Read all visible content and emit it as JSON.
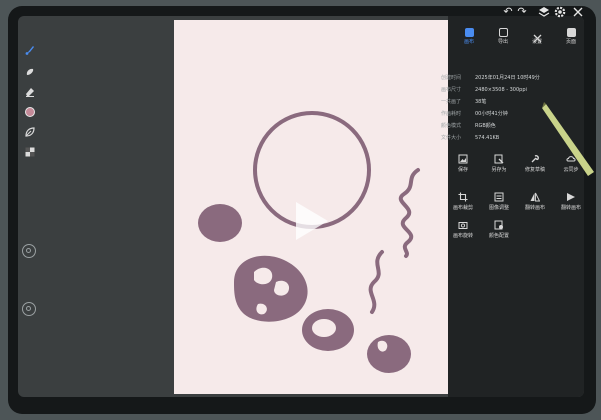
{
  "colors": {
    "canvas": "#f6eaea",
    "ink": "#8a6a7e",
    "panel": "#202324",
    "accent": "#4a8cf0"
  },
  "topbar": {
    "icons": [
      "undo-icon",
      "redo-icon",
      "layers-icon",
      "gear-icon",
      "close-icon"
    ]
  },
  "tabs": [
    {
      "label": "画布",
      "icon": "canvas-icon"
    },
    {
      "label": "导出",
      "icon": "export-icon"
    },
    {
      "label": "设置",
      "icon": "settings-icon"
    },
    {
      "label": "页面",
      "icon": "page-icon"
    }
  ],
  "info": [
    {
      "key": "创建时间",
      "value": "2025年01月24日 10时49分"
    },
    {
      "key": "画布尺寸",
      "value": "2480×3508 - 300ppi"
    },
    {
      "key": "一共画了",
      "value": "38笔"
    },
    {
      "key": "作画耗时",
      "value": "00小时41分钟"
    },
    {
      "key": "颜色模式",
      "value": "RGB颜色"
    },
    {
      "key": "文件大小",
      "value": "574.41KB"
    }
  ],
  "actions": [
    {
      "label": "保存",
      "icon": "image-icon"
    },
    {
      "label": "另存为",
      "icon": "save-as-icon"
    },
    {
      "label": "修复草稿",
      "icon": "wrench-icon"
    },
    {
      "label": "云同步",
      "icon": "cloud-icon"
    },
    {
      "label": "画布裁剪",
      "icon": "crop-icon"
    },
    {
      "label": "图像调整",
      "icon": "adjust-icon"
    },
    {
      "label": "翻转画布",
      "icon": "flip-horizontal-icon"
    },
    {
      "label": "翻转画布",
      "icon": "flip-vertical-icon"
    },
    {
      "label": "画布旋转",
      "icon": "camera-icon"
    },
    {
      "label": "颜色配置",
      "icon": "color-profile-icon"
    }
  ],
  "toolbar": {
    "tools": [
      "brush-icon",
      "smudge-icon",
      "eraser-icon",
      "color-swatch",
      "leaf-brush-icon",
      "layers-thumb-icon"
    ]
  }
}
